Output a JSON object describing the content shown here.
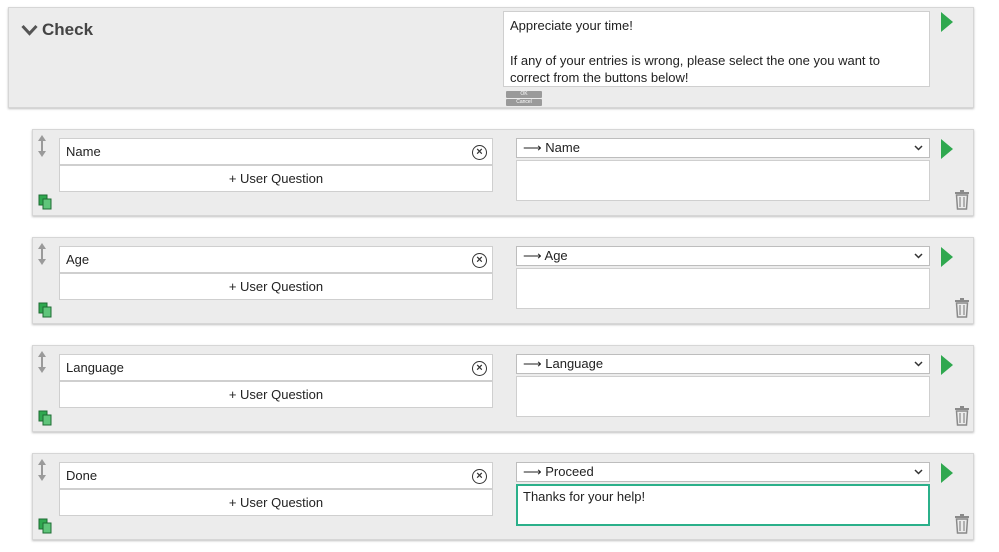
{
  "header": {
    "title": "Check",
    "message_line1": "Appreciate your time!",
    "message_line2": "If any of your entries is wrong, please select the one you want to correct from the buttons below!",
    "ok_label": "OK",
    "cancel_label": "Cancel"
  },
  "rows": [
    {
      "name": "Name",
      "add_label": "+ User Question",
      "target": "⟶ Name",
      "response": ""
    },
    {
      "name": "Age",
      "add_label": "+ User Question",
      "target": "⟶ Age",
      "response": ""
    },
    {
      "name": "Language",
      "add_label": "+ User Question",
      "target": "⟶ Language",
      "response": ""
    },
    {
      "name": "Done",
      "add_label": "+ User Question",
      "target": "⟶ Proceed",
      "response": "Thanks for your help!"
    }
  ],
  "colors": {
    "accent_green": "#2fa84f",
    "focus_border": "#2bb08a",
    "panel_bg": "#ececec"
  },
  "icons": [
    "chevron-down-icon",
    "play-icon",
    "drag-handle-icon",
    "copy-icon",
    "clear-icon",
    "trash-icon"
  ]
}
